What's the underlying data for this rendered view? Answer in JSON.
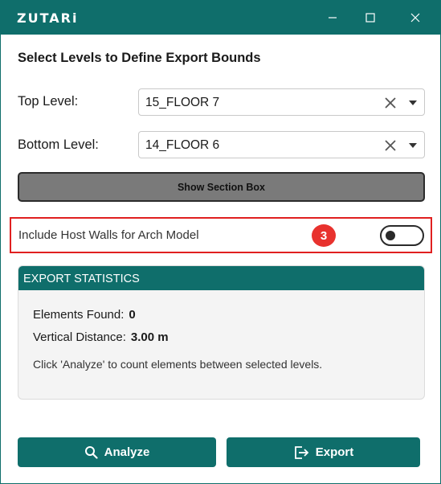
{
  "window": {
    "brand": "ZUTARi"
  },
  "titlebar_icons": {
    "minimize": "minimize-icon",
    "maximize": "maximize-icon",
    "close": "close-icon"
  },
  "form": {
    "heading": "Select Levels to Define Export Bounds",
    "top_level": {
      "label": "Top Level:",
      "value": "15_FLOOR 7"
    },
    "bottom_level": {
      "label": "Bottom Level:",
      "value": "14_FLOOR 6"
    },
    "section_box_button": "Show Section Box",
    "host_walls": {
      "label": "Include Host Walls for Arch Model",
      "step_badge": "3",
      "toggle_on": false
    }
  },
  "stats": {
    "header": "EXPORT STATISTICS",
    "elements_label": "Elements Found:",
    "elements_value": "0",
    "distance_label": "Vertical Distance:",
    "distance_value": "3.00 m",
    "hint": "Click 'Analyze' to count elements between selected levels."
  },
  "actions": {
    "analyze_label": "Analyze",
    "analyze_icon": "search-icon",
    "export_label": "Export",
    "export_icon": "export-icon"
  },
  "colors": {
    "brand": "#0f6e6b",
    "highlight": "#e02020",
    "badge": "#e8322e",
    "neutral_button": "#7a7a7a"
  }
}
